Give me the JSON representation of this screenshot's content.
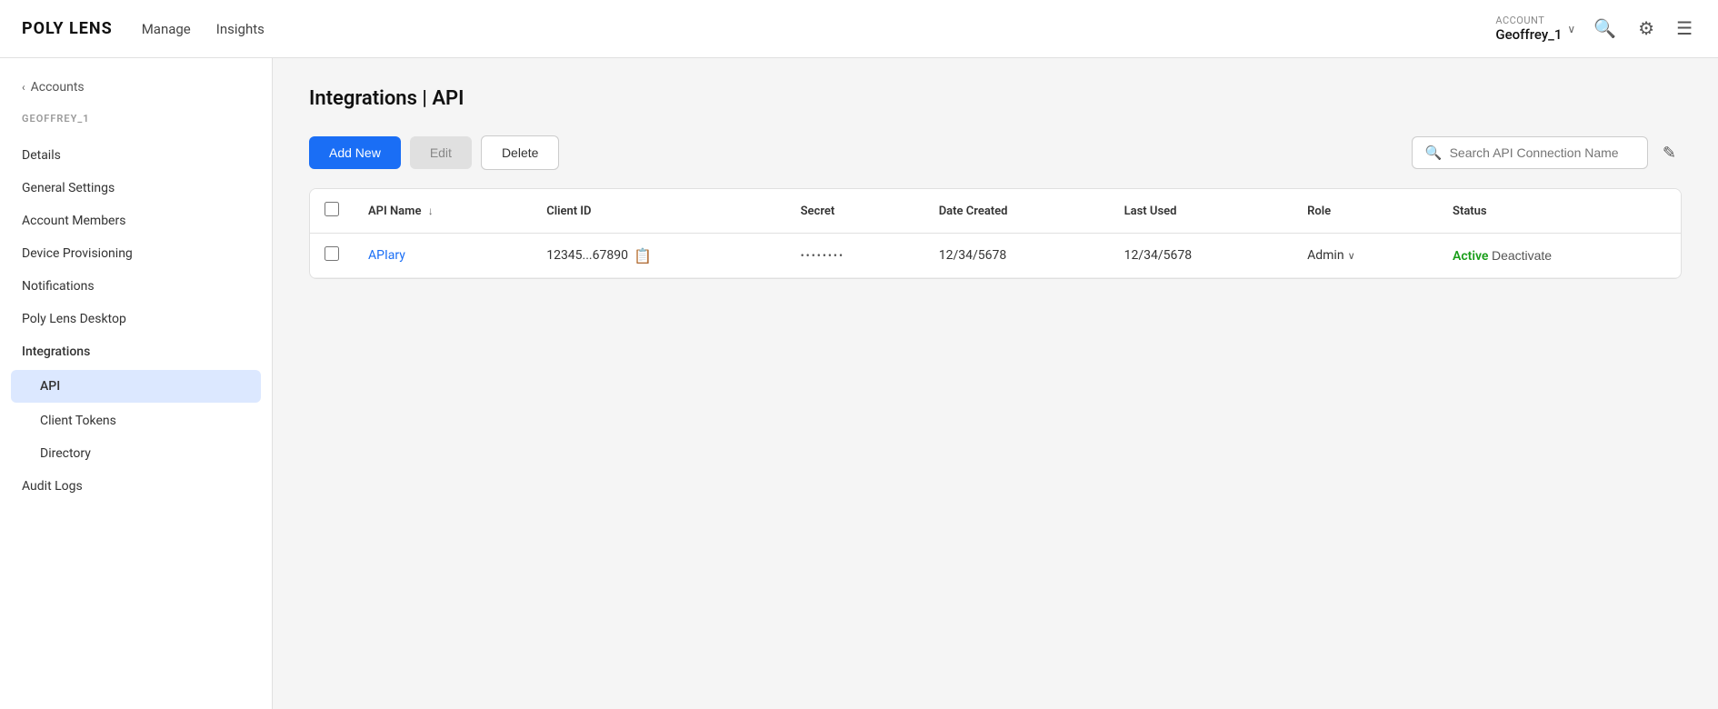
{
  "app": {
    "logo": "POLY LENS",
    "nav": {
      "manage": "Manage",
      "insights": "Insights"
    },
    "account": {
      "label": "ACCOUNT",
      "name": "Geoffrey_1"
    }
  },
  "sidebar": {
    "breadcrumb_icon": "‹",
    "breadcrumb_label": "Accounts",
    "account_section_label": "GEOFFREY_1",
    "items": [
      {
        "id": "details",
        "label": "Details",
        "active": false,
        "type": "item"
      },
      {
        "id": "general-settings",
        "label": "General Settings",
        "active": false,
        "type": "item"
      },
      {
        "id": "account-members",
        "label": "Account Members",
        "active": false,
        "type": "item"
      },
      {
        "id": "device-provisioning",
        "label": "Device Provisioning",
        "active": false,
        "type": "item"
      },
      {
        "id": "notifications",
        "label": "Notifications",
        "active": false,
        "type": "item"
      },
      {
        "id": "poly-lens-desktop",
        "label": "Poly Lens Desktop",
        "active": false,
        "type": "item"
      },
      {
        "id": "integrations",
        "label": "Integrations",
        "active": false,
        "type": "section"
      }
    ],
    "sub_items": [
      {
        "id": "api",
        "label": "API",
        "active": true
      },
      {
        "id": "client-tokens",
        "label": "Client Tokens",
        "active": false
      },
      {
        "id": "directory",
        "label": "Directory",
        "active": false
      }
    ],
    "bottom_items": [
      {
        "id": "audit-logs",
        "label": "Audit Logs",
        "active": false
      }
    ]
  },
  "main": {
    "page_title": "Integrations | API",
    "toolbar": {
      "add_new": "Add New",
      "edit": "Edit",
      "delete": "Delete",
      "search_placeholder": "Search API Connection Name"
    },
    "table": {
      "columns": [
        {
          "id": "api-name",
          "label": "API Name",
          "sortable": true
        },
        {
          "id": "client-id",
          "label": "Client ID",
          "sortable": false
        },
        {
          "id": "secret",
          "label": "Secret",
          "sortable": false
        },
        {
          "id": "date-created",
          "label": "Date Created",
          "sortable": false
        },
        {
          "id": "last-used",
          "label": "Last Used",
          "sortable": false
        },
        {
          "id": "role",
          "label": "Role",
          "sortable": false
        },
        {
          "id": "status",
          "label": "Status",
          "sortable": false
        }
      ],
      "rows": [
        {
          "id": "aplary",
          "api_name": "APIary",
          "client_id": "12345...67890",
          "secret": "••••••••",
          "date_created": "12/34/5678",
          "last_used": "12/34/5678",
          "role": "Admin",
          "status": "Active",
          "deactivate_label": "Deactivate"
        }
      ]
    }
  }
}
